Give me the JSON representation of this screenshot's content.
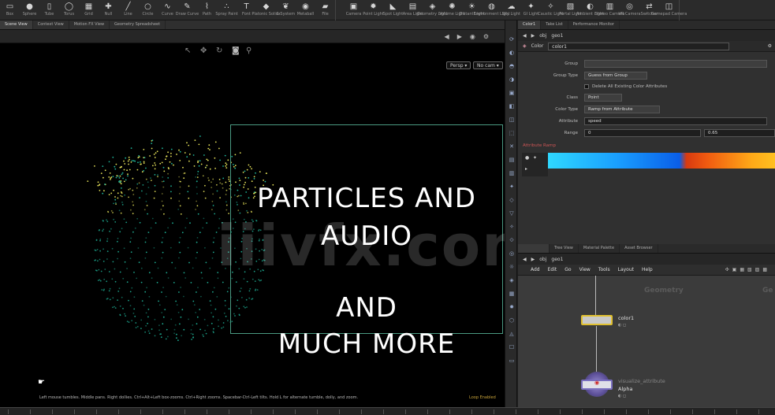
{
  "shelf": {
    "left_tools": [
      {
        "icon": "box-icon",
        "glyph": "▭",
        "label": "Box"
      },
      {
        "icon": "sphere-icon",
        "glyph": "●",
        "label": "Sphere"
      },
      {
        "icon": "tube-icon",
        "glyph": "▯",
        "label": "Tube"
      },
      {
        "icon": "torus-icon",
        "glyph": "◯",
        "label": "Torus"
      },
      {
        "icon": "grid-icon",
        "glyph": "▦",
        "label": "Grid"
      },
      {
        "icon": "null-icon",
        "glyph": "✚",
        "label": "Null"
      },
      {
        "icon": "line-icon",
        "glyph": "╱",
        "label": "Line"
      },
      {
        "icon": "circle-icon",
        "glyph": "○",
        "label": "Circle"
      },
      {
        "icon": "curve-icon",
        "glyph": "∿",
        "label": "Curve"
      },
      {
        "icon": "draw-curve-icon",
        "glyph": "✎",
        "label": "Draw Curve"
      },
      {
        "icon": "path-icon",
        "glyph": "⌇",
        "label": "Path"
      },
      {
        "icon": "spray-paint-icon",
        "glyph": "∴",
        "label": "Spray Paint"
      },
      {
        "icon": "font-icon",
        "glyph": "T",
        "label": "Font"
      },
      {
        "icon": "platonic-solids-icon",
        "glyph": "◆",
        "label": "Platonic Solids"
      },
      {
        "icon": "l-system-icon",
        "glyph": "❦",
        "label": "L-System"
      },
      {
        "icon": "metaball-icon",
        "glyph": "◉",
        "label": "Metaball"
      },
      {
        "icon": "file-icon",
        "glyph": "▰",
        "label": "File"
      }
    ],
    "right_tools": [
      {
        "icon": "camera-icon",
        "glyph": "▣",
        "label": "Camera"
      },
      {
        "icon": "point-light-icon",
        "glyph": "✹",
        "label": "Point Light"
      },
      {
        "icon": "spot-light-icon",
        "glyph": "◣",
        "label": "Spot Light"
      },
      {
        "icon": "area-light-icon",
        "glyph": "▤",
        "label": "Area Light"
      },
      {
        "icon": "geometry-light-icon",
        "glyph": "◈",
        "label": "Geometry Light"
      },
      {
        "icon": "volume-light-icon",
        "glyph": "✺",
        "label": "Volume Light"
      },
      {
        "icon": "distant-light-icon",
        "glyph": "☀",
        "label": "Distant Light"
      },
      {
        "icon": "environment-light-icon",
        "glyph": "◍",
        "label": "Environment Light"
      },
      {
        "icon": "sky-light-icon",
        "glyph": "☁",
        "label": "Sky Light"
      },
      {
        "icon": "gi-light-icon",
        "glyph": "✦",
        "label": "GI Light"
      },
      {
        "icon": "caustic-light-icon",
        "glyph": "✧",
        "label": "Caustic Light"
      },
      {
        "icon": "portal-light-icon",
        "glyph": "▧",
        "label": "Portal Light"
      },
      {
        "icon": "ambient-light-icon",
        "glyph": "◐",
        "label": "Ambient Light"
      },
      {
        "icon": "stereo-camera-icon",
        "glyph": "▥",
        "label": "Stereo Camera"
      },
      {
        "icon": "vr-camera-icon",
        "glyph": "◎",
        "label": "VR Camera"
      },
      {
        "icon": "switcher-icon",
        "glyph": "⇄",
        "label": "Switcher"
      },
      {
        "icon": "gamepad-camera-icon",
        "glyph": "◫",
        "label": "Gamepad Camera"
      }
    ]
  },
  "viewer": {
    "tabs": [
      "Scene View",
      "Context View",
      "Motion FX View",
      "Geometry Spreadsheet"
    ],
    "persp_label": "Persp ▾",
    "cam_label": "No cam ▾",
    "title_lines": [
      "PARTICLES AND",
      "AUDIO",
      "AND",
      "MUCH MORE"
    ],
    "watermark": "iiivfx.com",
    "help_text": "Left mouse tumbles. Middle pans. Right dollies. Ctrl+Alt+Left box-zooms. Ctrl+Right zooms. Spacebar-Ctrl-Left tilts. Hold L for alternate tumble, dolly, and zoom.",
    "status_right": "Loop Enabled"
  },
  "params": {
    "tabs": [
      "Color1",
      "Take List",
      "Performance Monitor"
    ],
    "path": [
      "obj",
      "geo1"
    ],
    "node_type": "Color",
    "node_name": "color1",
    "rows": [
      {
        "label": "Group",
        "value": ""
      },
      {
        "label": "Group Type",
        "value": "Guess from Group"
      },
      {
        "label": "",
        "value": "Delete All Existing Color Attributes"
      },
      {
        "label": "Class",
        "value": "Point"
      },
      {
        "label": "Color Type",
        "value": "Ramp from Attribute"
      },
      {
        "label": "Attribute",
        "value": "speed"
      },
      {
        "label": "Range",
        "value": "0",
        "value2": "0.65"
      }
    ],
    "ramp_label": "Attribute Ramp"
  },
  "network": {
    "tabs": [
      "",
      "Tree View",
      "Material Palette",
      "Asset Browser"
    ],
    "path": [
      "obj",
      "geo1"
    ],
    "menu": [
      "Add",
      "Edit",
      "Go",
      "View",
      "Tools",
      "Layout",
      "Help"
    ],
    "faded_text": [
      "Geometry",
      "Ge"
    ],
    "nodes": [
      {
        "name": "color1",
        "sub": ""
      },
      {
        "name": "visualize_attribute",
        "sub": "Alpha"
      }
    ]
  },
  "colors": {
    "title_frame": "#4a9a82",
    "particles_teal": "#1fb59a",
    "particles_yellow": "#e6e25a",
    "ramp_blue": "#1aa0ff",
    "ramp_orange": "#f05a10",
    "node_highlight": "#e0c030"
  }
}
